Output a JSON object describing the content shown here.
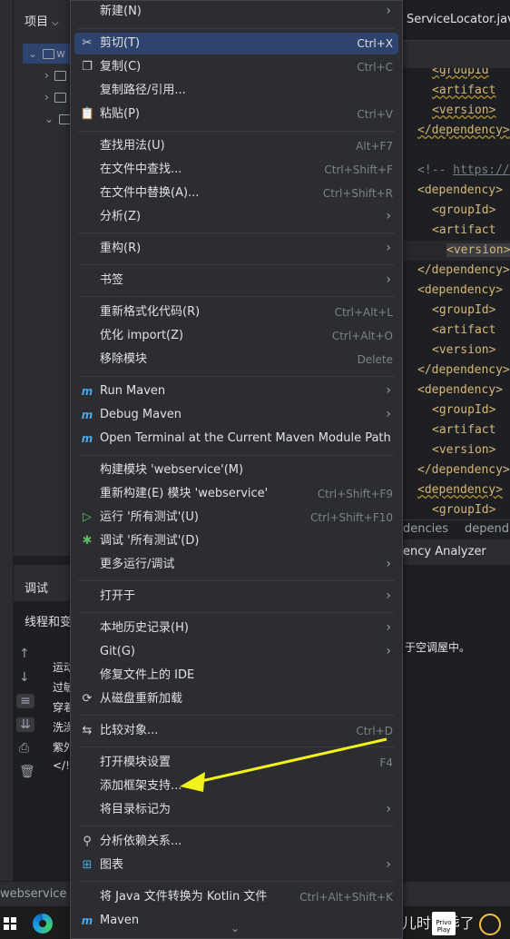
{
  "project_panel": {
    "title": "项目",
    "root_prefix": "w",
    "tree_items": [
      {
        "expand": "›"
      },
      {
        "expand": "›"
      },
      {
        "expand": "⌄"
      }
    ]
  },
  "editor": {
    "tab_title": "ServiceLocator.jav",
    "code_lines": [
      {
        "text": "  <groupId",
        "style": "warn-top"
      },
      {
        "text": "    <artifact",
        "style": "warn"
      },
      {
        "text": "    <version>",
        "style": "warn"
      },
      {
        "text": "</dependency>",
        "style": "warn"
      },
      {
        "text": "",
        "style": ""
      },
      {
        "text": "<!-- https://",
        "style": "comment"
      },
      {
        "text": "<dependency>",
        "style": ""
      },
      {
        "text": "    <groupId>",
        "style": ""
      },
      {
        "text": "    <artifact",
        "style": ""
      },
      {
        "text": "    <version>",
        "style": "boxed"
      },
      {
        "text": "</dependency>",
        "style": ""
      },
      {
        "text": "<dependency>",
        "style": ""
      },
      {
        "text": "    <groupId>",
        "style": ""
      },
      {
        "text": "    <artifact",
        "style": ""
      },
      {
        "text": "    <version>",
        "style": ""
      },
      {
        "text": "</dependency>",
        "style": ""
      },
      {
        "text": "<dependency>",
        "style": ""
      },
      {
        "text": "    <groupId>",
        "style": ""
      },
      {
        "text": "    <artifact",
        "style": ""
      },
      {
        "text": "    <version>",
        "style": ""
      },
      {
        "text": "</dependency>",
        "style": ""
      },
      {
        "text": "<dependency>",
        "style": "warn"
      },
      {
        "text": "    <groupId>",
        "style": ""
      }
    ],
    "breadcrumbs": [
      "dencies",
      "depend"
    ],
    "analyzer_tab": "ency Analyzer"
  },
  "debug": {
    "title": "调试",
    "subtitle": "线程和变",
    "console_lines": [
      "运动",
      "过敏",
      "穿着",
      "洗澡",
      "紫外",
      "</!"
    ],
    "console_right": "于空调屋中。"
  },
  "statusbar": {
    "text": "webservice"
  },
  "taskbar": {
    "watermark": "CSDN @儿时可乖了",
    "tray_label": "Privo\nPlay"
  },
  "menu": {
    "items": [
      {
        "id": "new",
        "label": "新建(N)",
        "shortcut": "",
        "submenu": true,
        "icon": ""
      },
      {
        "id": "cut",
        "label": "剪切(T)",
        "shortcut": "Ctrl+X",
        "submenu": false,
        "icon": "✂",
        "selected": true
      },
      {
        "id": "copy",
        "label": "复制(C)",
        "shortcut": "Ctrl+C",
        "submenu": false,
        "icon": "❐"
      },
      {
        "id": "copy-path",
        "label": "复制路径/引用...",
        "shortcut": "",
        "submenu": false,
        "icon": ""
      },
      {
        "id": "paste",
        "label": "粘贴(P)",
        "shortcut": "Ctrl+V",
        "submenu": false,
        "icon": "📋"
      },
      {
        "id": "find-usages",
        "label": "查找用法(U)",
        "shortcut": "Alt+F7",
        "submenu": false,
        "icon": ""
      },
      {
        "id": "find-in-files",
        "label": "在文件中查找...",
        "shortcut": "Ctrl+Shift+F",
        "submenu": false,
        "icon": ""
      },
      {
        "id": "replace-in-files",
        "label": "在文件中替换(A)...",
        "shortcut": "Ctrl+Shift+R",
        "submenu": false,
        "icon": ""
      },
      {
        "id": "analyze",
        "label": "分析(Z)",
        "shortcut": "",
        "submenu": true,
        "icon": ""
      },
      {
        "id": "refactor",
        "label": "重构(R)",
        "shortcut": "",
        "submenu": true,
        "icon": ""
      },
      {
        "id": "bookmarks",
        "label": "书签",
        "shortcut": "",
        "submenu": true,
        "icon": ""
      },
      {
        "id": "reformat",
        "label": "重新格式化代码(R)",
        "shortcut": "Ctrl+Alt+L",
        "submenu": false,
        "icon": ""
      },
      {
        "id": "optimize-imports",
        "label": "优化 import(Z)",
        "shortcut": "Ctrl+Alt+O",
        "submenu": false,
        "icon": ""
      },
      {
        "id": "remove-module",
        "label": "移除模块",
        "shortcut": "Delete",
        "submenu": false,
        "icon": ""
      },
      {
        "id": "run-maven",
        "label": "Run Maven",
        "shortcut": "",
        "submenu": true,
        "icon": "m"
      },
      {
        "id": "debug-maven",
        "label": "Debug Maven",
        "shortcut": "",
        "submenu": true,
        "icon": "m"
      },
      {
        "id": "open-terminal-maven",
        "label": "Open Terminal at the Current Maven Module Path",
        "shortcut": "",
        "submenu": false,
        "icon": "m"
      },
      {
        "id": "build-module",
        "label": "构建模块 'webservice'(M)",
        "shortcut": "",
        "submenu": false,
        "icon": ""
      },
      {
        "id": "rebuild-module",
        "label": "重新构建(E) 模块 'webservice'",
        "shortcut": "Ctrl+Shift+F9",
        "submenu": false,
        "icon": ""
      },
      {
        "id": "run-all-tests",
        "label": "运行 '所有测试'(U)",
        "shortcut": "Ctrl+Shift+F10",
        "submenu": false,
        "icon": "▷"
      },
      {
        "id": "debug-all-tests",
        "label": "调试 '所有测试'(D)",
        "shortcut": "",
        "submenu": false,
        "icon": "✱"
      },
      {
        "id": "more-run-debug",
        "label": "更多运行/调试",
        "shortcut": "",
        "submenu": true,
        "icon": ""
      },
      {
        "id": "open-in",
        "label": "打开于",
        "shortcut": "",
        "submenu": true,
        "icon": ""
      },
      {
        "id": "local-history",
        "label": "本地历史记录(H)",
        "shortcut": "",
        "submenu": true,
        "icon": ""
      },
      {
        "id": "git",
        "label": "Git(G)",
        "shortcut": "",
        "submenu": true,
        "icon": ""
      },
      {
        "id": "repair-ide",
        "label": "修复文件上的 IDE",
        "shortcut": "",
        "submenu": false,
        "icon": ""
      },
      {
        "id": "reload-from-disk",
        "label": "从磁盘重新加载",
        "shortcut": "",
        "submenu": false,
        "icon": "⟳"
      },
      {
        "id": "compare-with",
        "label": "比较对象...",
        "shortcut": "Ctrl+D",
        "submenu": false,
        "icon": "⇆"
      },
      {
        "id": "module-settings",
        "label": "打开模块设置",
        "shortcut": "F4",
        "submenu": false,
        "icon": ""
      },
      {
        "id": "add-framework",
        "label": "添加框架支持...",
        "shortcut": "",
        "submenu": false,
        "icon": ""
      },
      {
        "id": "mark-directory",
        "label": "将目录标记为",
        "shortcut": "",
        "submenu": true,
        "icon": ""
      },
      {
        "id": "analyze-deps",
        "label": "分析依赖关系...",
        "shortcut": "",
        "submenu": false,
        "icon": "⚲"
      },
      {
        "id": "diagrams",
        "label": "图表",
        "shortcut": "",
        "submenu": true,
        "icon": "⊞"
      },
      {
        "id": "convert-kotlin",
        "label": "将 Java 文件转换为 Kotlin 文件",
        "shortcut": "Ctrl+Alt+Shift+K",
        "submenu": false,
        "icon": ""
      },
      {
        "id": "maven",
        "label": "Maven",
        "shortcut": "",
        "submenu": false,
        "icon": "m"
      }
    ],
    "scroll_indicator": "⌄"
  },
  "annotation_color": "#f2f21a"
}
